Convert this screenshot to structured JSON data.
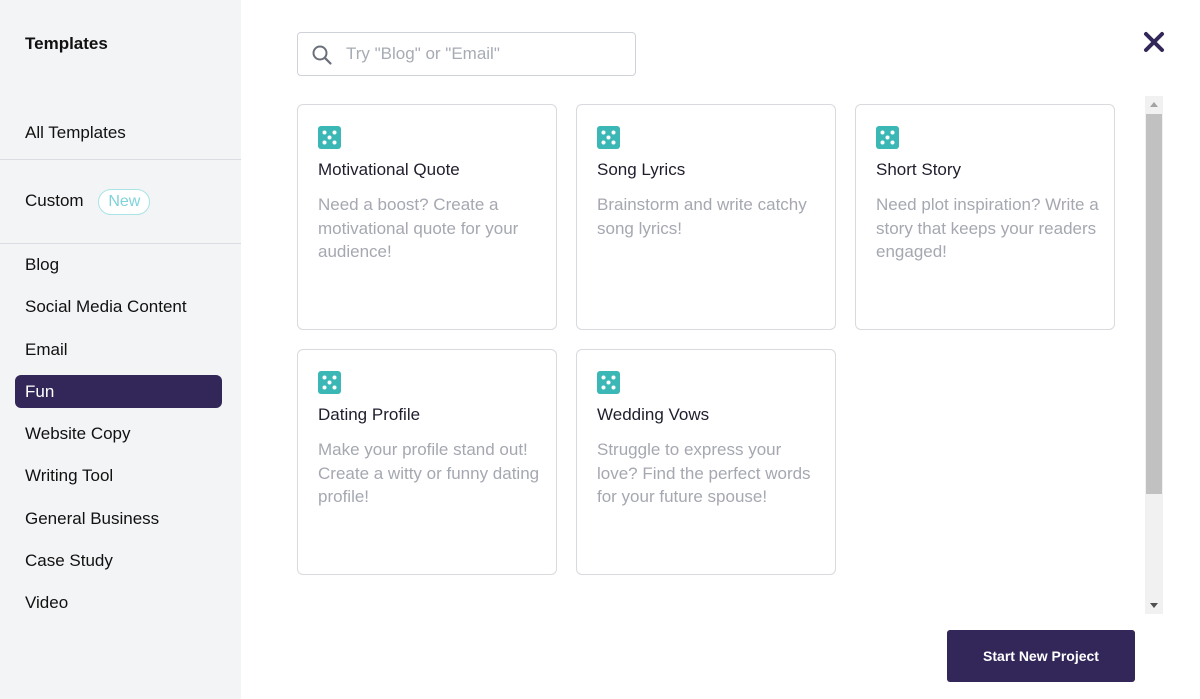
{
  "sidebar": {
    "title": "Templates",
    "all_templates": "All Templates",
    "custom": {
      "label": "Custom",
      "badge": "New"
    },
    "items": [
      {
        "label": "Blog"
      },
      {
        "label": "Social Media Content"
      },
      {
        "label": "Email"
      },
      {
        "label": "Fun",
        "active": true
      },
      {
        "label": "Website Copy"
      },
      {
        "label": "Writing Tool"
      },
      {
        "label": "General Business"
      },
      {
        "label": "Case Study"
      },
      {
        "label": "Video"
      }
    ]
  },
  "search": {
    "placeholder": "Try \"Blog\" or \"Email\"",
    "icon": "search-icon"
  },
  "close_icon": "close-icon",
  "templates": [
    {
      "title": "Motivational Quote",
      "description": "Need a boost? Create a motivational quote for your audience!",
      "icon": "dice-icon"
    },
    {
      "title": "Song Lyrics",
      "description": "Brainstorm and write catchy song lyrics!",
      "icon": "dice-icon"
    },
    {
      "title": "Short Story",
      "description": "Need plot inspiration? Write a story that keeps your readers engaged!",
      "icon": "dice-icon"
    },
    {
      "title": "Dating Profile",
      "description": "Make your profile stand out! Create a witty or funny dating profile!",
      "icon": "dice-icon"
    },
    {
      "title": "Wedding Vows",
      "description": "Struggle to express your love? Find the perfect words for your future spouse!",
      "icon": "dice-icon"
    }
  ],
  "start_button": "Start New Project",
  "colors": {
    "accent": "#33275a",
    "icon_teal": "#3bb8b6",
    "badge": "#7fd3d9",
    "sidebar_bg": "#f3f4f6"
  }
}
